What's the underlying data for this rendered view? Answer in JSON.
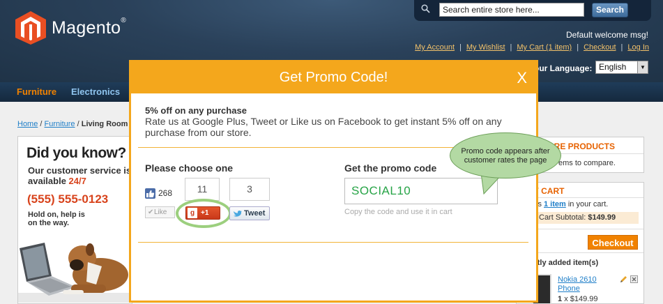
{
  "header": {
    "logo_text": "Magento",
    "logo_mark": "®",
    "search": {
      "placeholder": "Search entire store here...",
      "button_label": "Search"
    },
    "welcome": "Default welcome msg!",
    "account_links": [
      "My Account",
      "My Wishlist",
      "My Cart (1 item)",
      "Checkout",
      "Log In"
    ],
    "language_label": "our Language:",
    "language_value": "English"
  },
  "nav": {
    "items": [
      "Furniture",
      "Electronics"
    ],
    "active_color": "#f18200",
    "color": "#8fc4ee"
  },
  "breadcrumb": {
    "home": "Home",
    "furniture": "Furniture",
    "current": "Living Room",
    "sep": "/"
  },
  "promo_sidebar": {
    "title": "Did you know?",
    "line1": "Our customer service is",
    "line2_prefix": "available ",
    "line2_highlight": "24/7",
    "phone": "(555) 555-0123",
    "hold1": "Hold on, help is",
    "hold2": "on the way."
  },
  "right": {
    "compare_title": "ARE PRODUCTS",
    "compare_text": "ems to compare.",
    "cart_title": "Y CART",
    "cart_prefix": "is ",
    "cart_link": "1 item",
    "cart_suffix": " in your cart.",
    "subtotal_label": "Cart Subtotal:",
    "subtotal_value": "$149.99",
    "checkout": "Checkout",
    "recent_title": "ntly added item(s)",
    "product_name_1": "Nokia 2610",
    "product_name_2": "Phone",
    "product_qty": "1",
    "product_price": "x $149.99"
  },
  "modal": {
    "title": "Get Promo Code!",
    "close": "X",
    "offer_title": "5% off on any purchase",
    "offer_desc": "Rate us at Google Plus, Tweet or Like us on Facebook to get instant 5% off on any purchase from our store.",
    "choose_title": "Please choose one",
    "facebook": {
      "count": "268",
      "button": "Like"
    },
    "google": {
      "count": "11",
      "button": "+1"
    },
    "twitter": {
      "count": "3",
      "button": "Tweet"
    },
    "promo_title": "Get the promo code",
    "promo_code": "SOCIAL10",
    "promo_hint": "Copy the code and use it in cart"
  },
  "annotation": {
    "text": "Promo code appears after customer rates the page"
  },
  "colors": {
    "header_bg": "#2a415a",
    "modal_accent": "#f4a71c",
    "promo_code": "#27a447",
    "bubble": "#b3d9a3"
  }
}
